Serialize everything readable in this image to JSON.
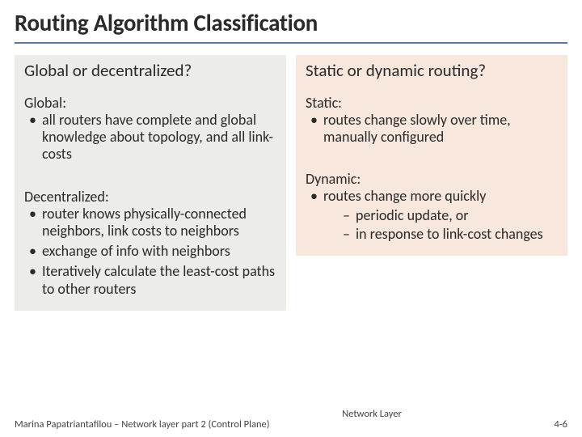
{
  "title": "Routing Algorithm Classification",
  "left": {
    "question": "Global or decentralized?",
    "sec1": {
      "heading": "Global:",
      "bullets": [
        "all routers have complete and global knowledge about topology, and all link-costs"
      ]
    },
    "sec2": {
      "heading": "Decentralized:",
      "bullets": [
        "router knows physically-connected neighbors, link costs to neighbors",
        "exchange of info with neighbors",
        "Iteratively calculate the least-cost paths to other routers"
      ]
    }
  },
  "right": {
    "question": "Static or dynamic routing?",
    "sec1": {
      "heading": "Static:",
      "bullets": [
        "routes change slowly over time, manually configured"
      ]
    },
    "sec2": {
      "heading": "Dynamic:",
      "bullets": [
        "routes change more quickly"
      ],
      "sub": [
        "periodic update, or",
        "in response to link-cost changes"
      ]
    }
  },
  "footer": {
    "top": "Network Layer",
    "left": "Marina Papatriantafilou – Network layer part 2 (Control Plane)",
    "right": "4-6"
  }
}
